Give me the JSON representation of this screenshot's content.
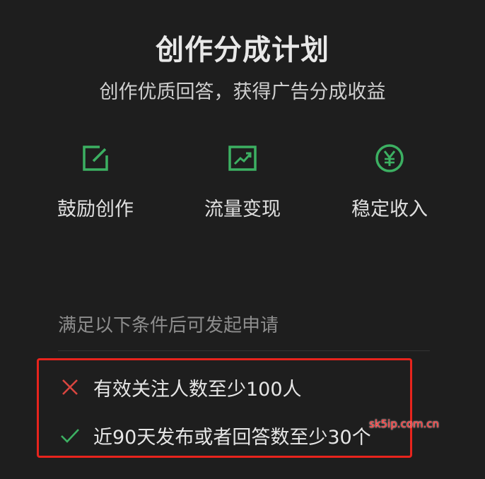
{
  "header": {
    "title": "创作分成计划",
    "subtitle": "创作优质回答，获得广告分成收益"
  },
  "features": [
    {
      "icon": "edit-square-icon",
      "label": "鼓励创作"
    },
    {
      "icon": "trend-chart-icon",
      "label": "流量变现"
    },
    {
      "icon": "yen-circle-icon",
      "label": "稳定收入"
    }
  ],
  "conditions": {
    "header": "满足以下条件后可发起申请",
    "items": [
      {
        "status": "unmet",
        "icon": "cross-icon",
        "text": "有效关注人数至少100人"
      },
      {
        "status": "met",
        "icon": "check-icon",
        "text": "近90天发布或者回答数至少30个"
      }
    ]
  },
  "watermark": "sk5ip.com.cn",
  "colors": {
    "background": "#1e1e1e",
    "accent_green": "#3cb062",
    "unmet_red": "#d9453f",
    "highlight_border": "#e8241d"
  }
}
